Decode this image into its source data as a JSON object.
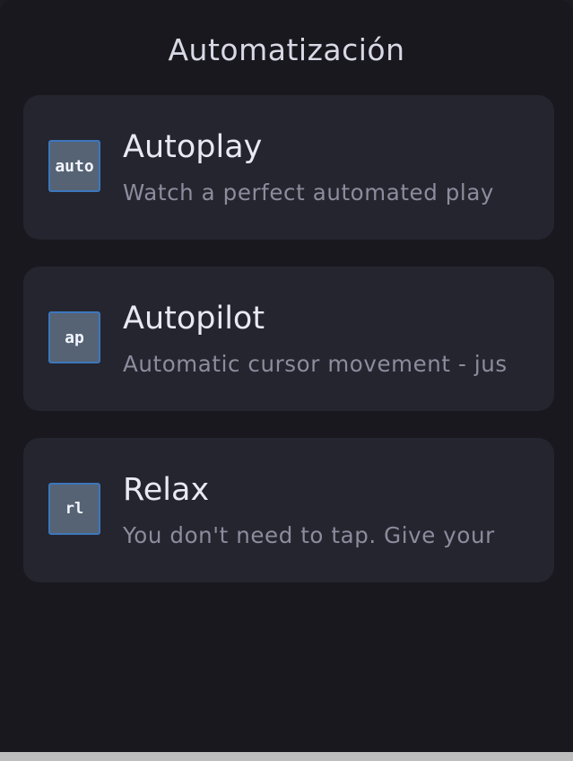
{
  "header": {
    "title": "Automatización"
  },
  "mods": [
    {
      "icon_text": "auto",
      "icon": "autoplay-icon",
      "name": "Autoplay",
      "description": "Watch a perfect automated play"
    },
    {
      "icon_text": "ap",
      "icon": "autopilot-icon",
      "name": "Autopilot",
      "description": "Automatic cursor movement - jus"
    },
    {
      "icon_text": "rl",
      "icon": "relax-icon",
      "name": "Relax",
      "description": "You don't need to tap. Give your"
    }
  ],
  "colors": {
    "panel_background": "#18181e",
    "card_background": "#25252f",
    "icon_border": "#3c77bd",
    "icon_fill": "#566374",
    "title_text": "#d9d9e6",
    "description_text": "#8c8c9e"
  }
}
